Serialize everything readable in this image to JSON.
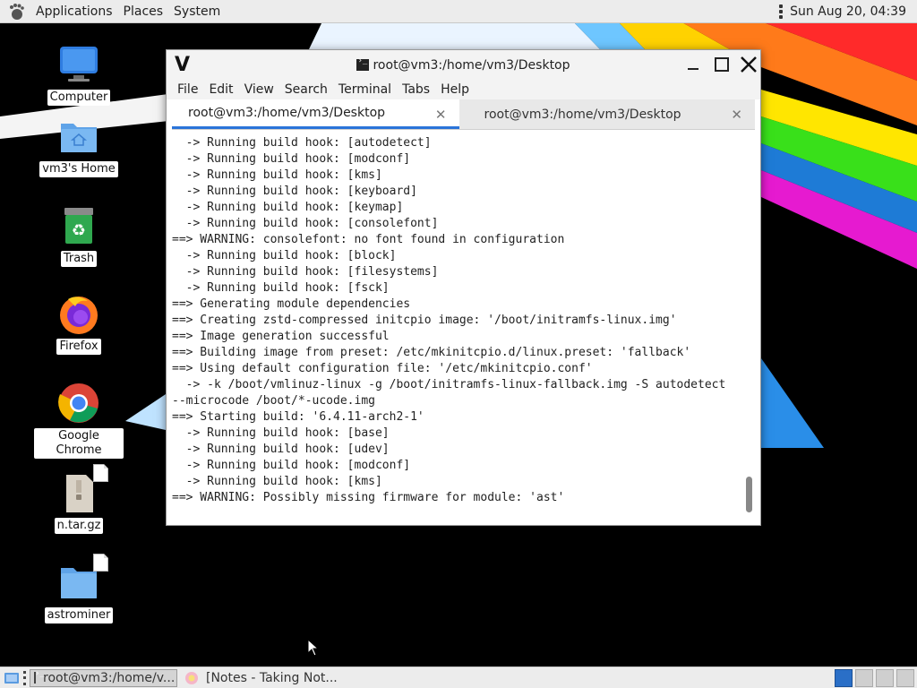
{
  "top_panel": {
    "menus": [
      "Applications",
      "Places",
      "System"
    ],
    "clock": "Sun Aug 20, 04:39"
  },
  "desktop_icons": [
    {
      "label": "Computer",
      "icon": "computer-icon"
    },
    {
      "label": "vm3's Home",
      "icon": "home-folder-icon"
    },
    {
      "label": "Trash",
      "icon": "trash-icon"
    },
    {
      "label": "Firefox",
      "icon": "firefox-icon"
    },
    {
      "label": "Google Chrome",
      "icon": "chrome-icon"
    },
    {
      "label": "n.tar.gz",
      "icon": "archive-icon"
    },
    {
      "label": "astrominer",
      "icon": "folder-icon"
    }
  ],
  "terminal": {
    "title": "root@vm3:/home/vm3/Desktop",
    "menu": [
      "File",
      "Edit",
      "View",
      "Search",
      "Terminal",
      "Tabs",
      "Help"
    ],
    "tabs": [
      {
        "label": "root@vm3:/home/vm3/Desktop",
        "active": true
      },
      {
        "label": "root@vm3:/home/vm3/Desktop",
        "active": false
      }
    ],
    "lines": [
      "  -> Running build hook: [autodetect]",
      "  -> Running build hook: [modconf]",
      "  -> Running build hook: [kms]",
      "  -> Running build hook: [keyboard]",
      "  -> Running build hook: [keymap]",
      "  -> Running build hook: [consolefont]",
      "==> WARNING: consolefont: no font found in configuration",
      "  -> Running build hook: [block]",
      "  -> Running build hook: [filesystems]",
      "  -> Running build hook: [fsck]",
      "==> Generating module dependencies",
      "==> Creating zstd-compressed initcpio image: '/boot/initramfs-linux.img'",
      "==> Image generation successful",
      "==> Building image from preset: /etc/mkinitcpio.d/linux.preset: 'fallback'",
      "==> Using default configuration file: '/etc/mkinitcpio.conf'",
      "  -> -k /boot/vmlinuz-linux -g /boot/initramfs-linux-fallback.img -S autodetect",
      "--microcode /boot/*-ucode.img",
      "==> Starting build: '6.4.11-arch2-1'",
      "  -> Running build hook: [base]",
      "  -> Running build hook: [udev]",
      "  -> Running build hook: [modconf]",
      "  -> Running build hook: [kms]",
      "==> WARNING: Possibly missing firmware for module: 'ast'"
    ]
  },
  "taskbar": {
    "tasks": [
      {
        "label": "root@vm3:/home/v...",
        "active": true
      },
      {
        "label": "[Notes - Taking Not...",
        "active": false
      }
    ]
  },
  "colors": {
    "accent": "#2a74d9",
    "panel_bg": "#ececec"
  }
}
